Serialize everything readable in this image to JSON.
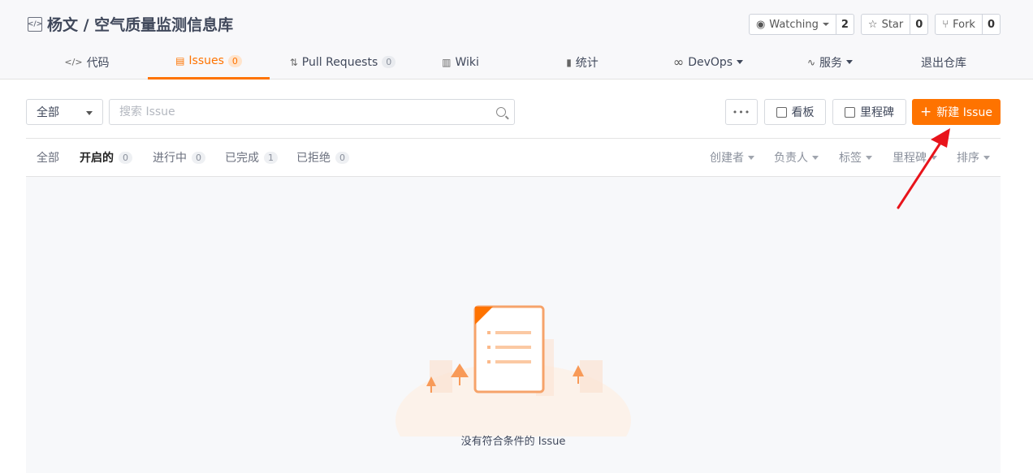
{
  "repo": {
    "title": "杨文 / 空气质量监测信息库",
    "watch": {
      "label": "Watching",
      "count": "2"
    },
    "star": {
      "label": "Star",
      "count": "0"
    },
    "fork": {
      "label": "Fork",
      "count": "0"
    }
  },
  "tabs": [
    {
      "label": "代码",
      "icon": "code-icon"
    },
    {
      "label": "Issues",
      "badge": "0",
      "icon": "issues-icon"
    },
    {
      "label": "Pull Requests",
      "badge": "0",
      "icon": "pull-request-icon"
    },
    {
      "label": "Wiki",
      "icon": "wiki-icon"
    },
    {
      "label": "统计",
      "icon": "chart-icon"
    },
    {
      "label": "DevOps",
      "icon": "infinity-icon"
    },
    {
      "label": "服务",
      "icon": "pulse-icon"
    },
    {
      "label": "退出仓库"
    }
  ],
  "toolbar": {
    "scope": "全部",
    "search_placeholder": "搜索 Issue",
    "more": "•••",
    "board": "看板",
    "milestone": "里程碑",
    "new_issue": "新建 Issue"
  },
  "filters": {
    "states": [
      {
        "label": "全部"
      },
      {
        "label": "开启的",
        "count": "0"
      },
      {
        "label": "进行中",
        "count": "0"
      },
      {
        "label": "已完成",
        "count": "1"
      },
      {
        "label": "已拒绝",
        "count": "0"
      }
    ],
    "dropdowns": [
      "创建者",
      "负责人",
      "标签",
      "里程碑",
      "排序"
    ]
  },
  "empty": {
    "message": "没有符合条件的 Issue"
  },
  "colors": {
    "accent": "#fe7300",
    "annotation_arrow": "#e8141b"
  }
}
